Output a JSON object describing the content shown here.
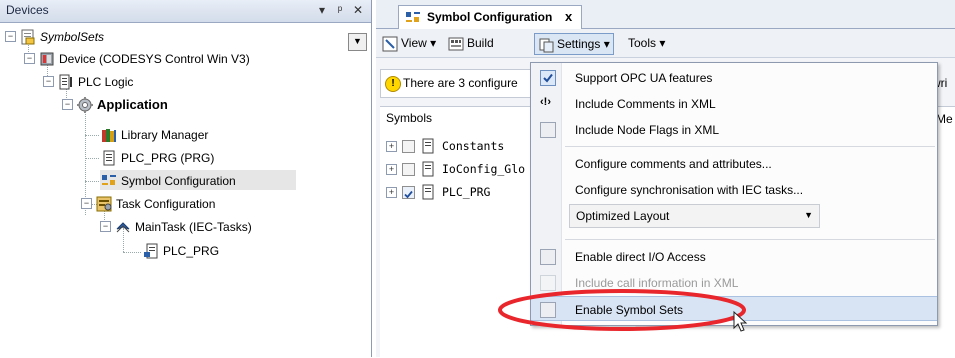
{
  "devices_pane": {
    "title": "Devices",
    "tree": [
      {
        "label": "SymbolSets",
        "italic": true
      },
      {
        "label": "Device (CODESYS Control Win V3)"
      },
      {
        "label": "PLC Logic"
      },
      {
        "label": "Application",
        "bold": true
      },
      {
        "label": "Library Manager"
      },
      {
        "label": "PLC_PRG (PRG)"
      },
      {
        "label": "Symbol Configuration",
        "selected": true
      },
      {
        "label": "Task Configuration"
      },
      {
        "label": "MainTask (IEC-Tasks)"
      },
      {
        "label": "PLC_PRG"
      }
    ]
  },
  "editor": {
    "tab_title": "Symbol Configuration",
    "tab_close": "x",
    "toolbar": {
      "view": "View",
      "build": "Build",
      "settings": "Settings",
      "tools": "Tools"
    },
    "info_text": "There are 3 configure",
    "info_right": "wri",
    "symbols_header": "Symbols",
    "header_right": "Me",
    "symbols": [
      {
        "label": "Constants",
        "checked": false
      },
      {
        "label": "IoConfig_Glo",
        "checked": false
      },
      {
        "label": "PLC_PRG",
        "checked": true
      }
    ]
  },
  "settings_menu": {
    "items": [
      {
        "label": "Support OPC UA features",
        "checked": true
      },
      {
        "label": "Include Comments in XML",
        "icon": "comment-tag-icon"
      },
      {
        "label": "Include Node Flags in XML",
        "checked": false
      },
      {
        "label": "Configure comments and attributes..."
      },
      {
        "label": "Configure synchronisation with IEC tasks..."
      },
      {
        "label": "Enable direct I/O Access",
        "checked": false
      },
      {
        "label": "Include call information in XML",
        "checked": false,
        "disabled": true
      },
      {
        "label": "Enable Symbol Sets",
        "checked": false,
        "highlighted": true
      }
    ],
    "layout_select": {
      "value": "Optimized Layout"
    }
  },
  "colors": {
    "annotation": "#e8262b",
    "menu_highlight": "#d8e3f3",
    "panel_title": "#d3dcea"
  }
}
